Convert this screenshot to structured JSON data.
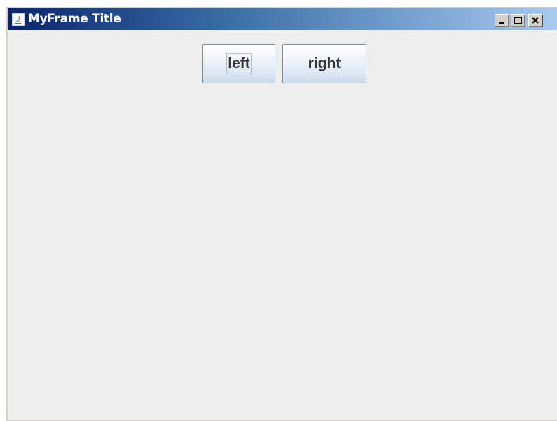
{
  "window": {
    "title": "MyFrame Title",
    "app_icon": "java-coffee-cup-icon",
    "controls": {
      "minimize_icon": "minimize-icon",
      "maximize_icon": "maximize-icon",
      "close_icon": "close-icon"
    }
  },
  "buttons": {
    "left_label": "left",
    "right_label": "right"
  },
  "colors": {
    "titlebar_start": "#0a246a",
    "titlebar_end": "#a6caf0",
    "content_background": "#eeeeee",
    "button_text": "#333333"
  }
}
